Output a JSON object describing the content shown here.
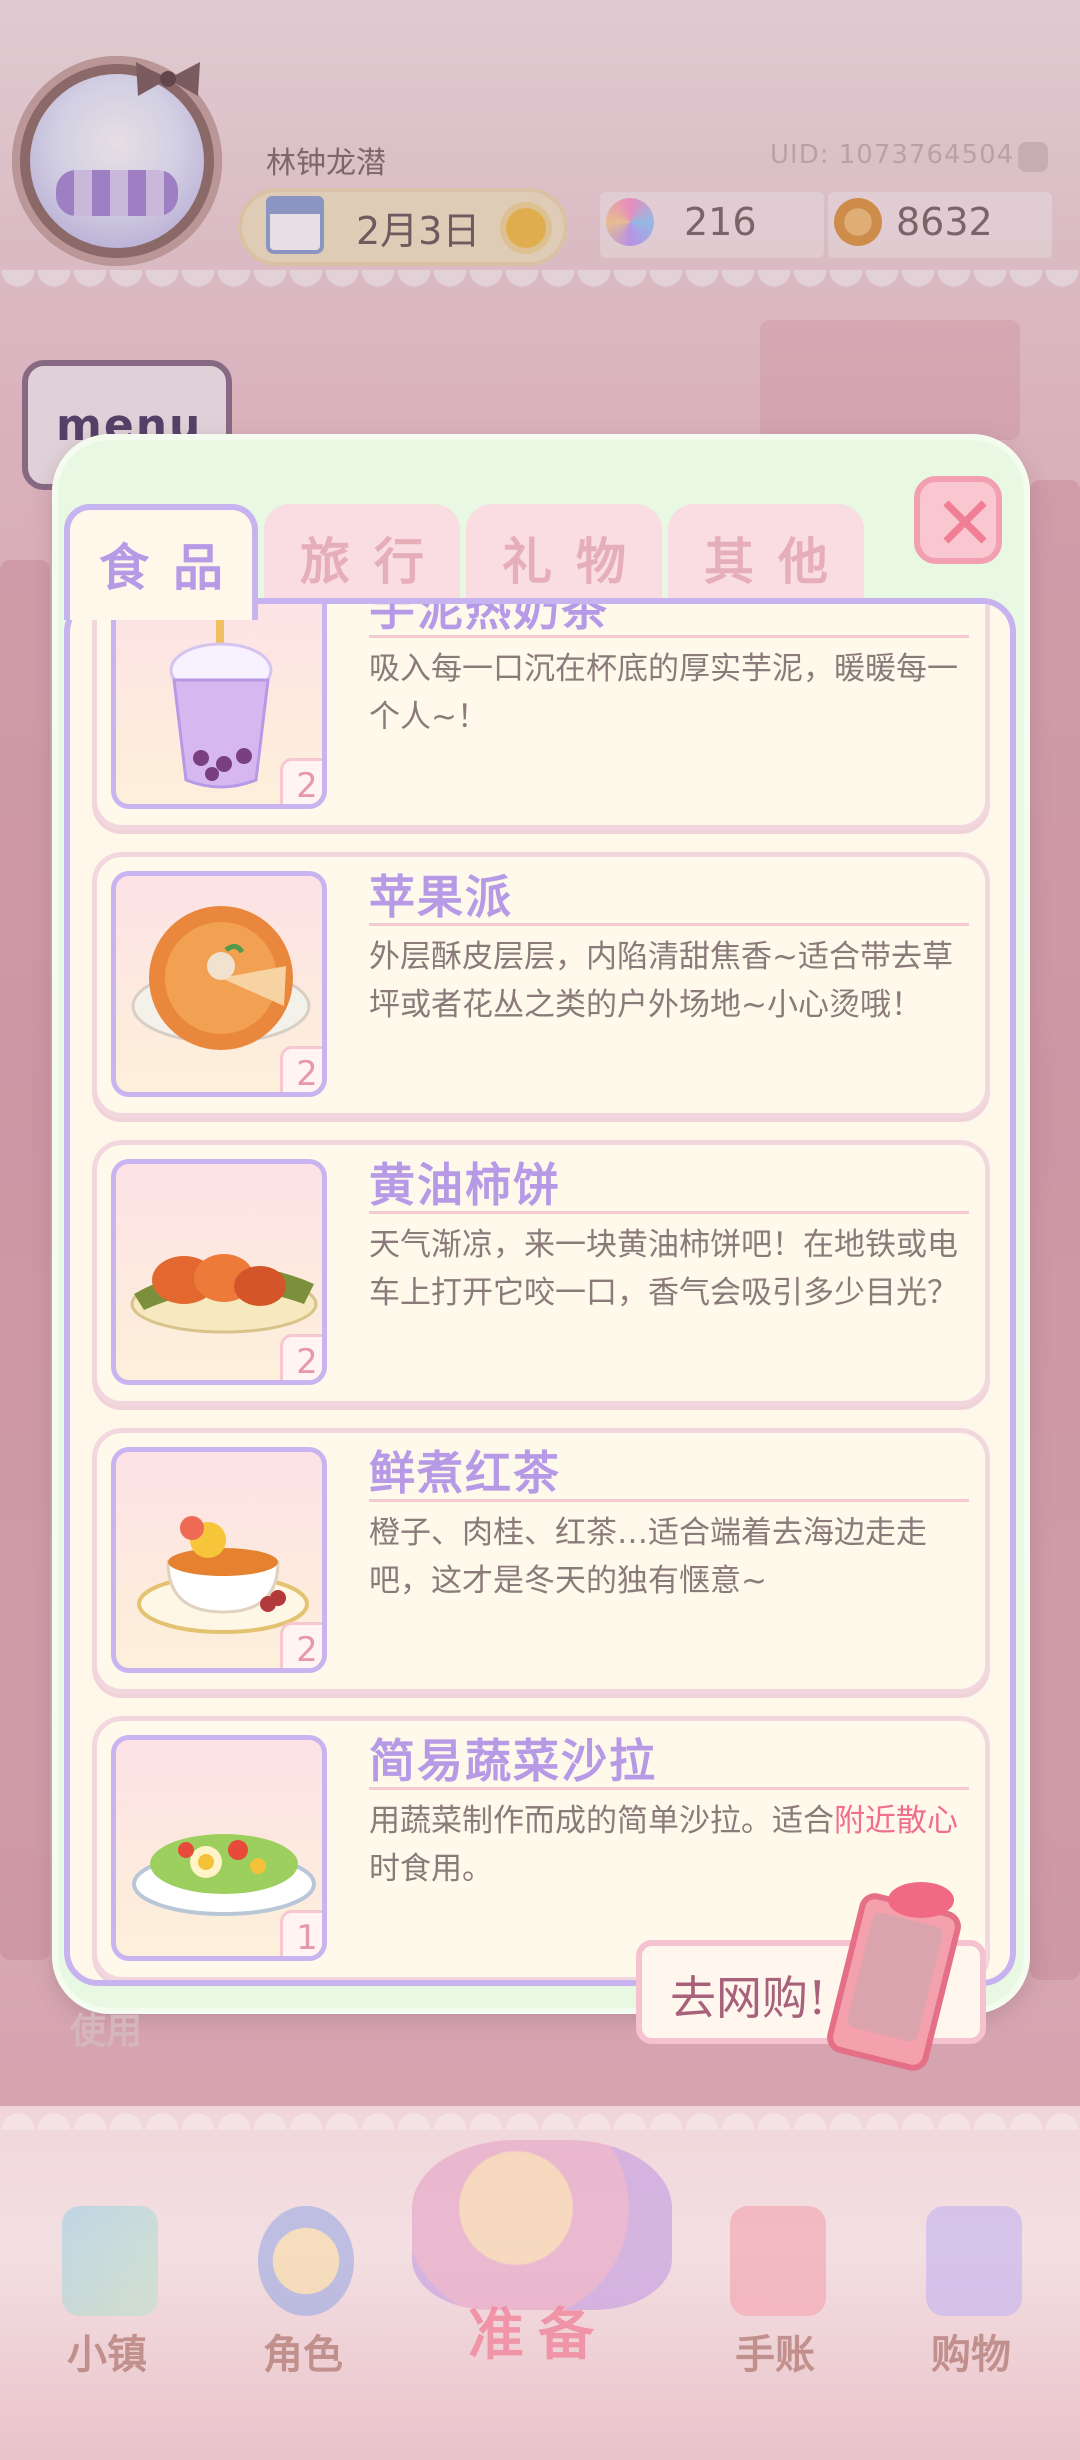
{
  "header": {
    "username": "林钟龙潜",
    "uid": "UID: 1073764504",
    "date": "2月3日",
    "gems": "216",
    "coins": "8632",
    "menu_label": "menu"
  },
  "tabs": [
    {
      "label": "食品",
      "active": true
    },
    {
      "label": "旅行",
      "active": false
    },
    {
      "label": "礼物",
      "active": false
    },
    {
      "label": "其他",
      "active": false
    }
  ],
  "items": [
    {
      "title": "芋泥热奶茶",
      "desc": "吸入每一口沉在杯底的厚实芋泥，暖暖每一个人~！",
      "qty": "2",
      "icon": "taro-milk-tea-icon"
    },
    {
      "title": "苹果派",
      "desc": "外层酥皮层层，内陷清甜焦香~适合带去草坪或者花丛之类的户外场地~小心烫哦！",
      "qty": "2",
      "icon": "apple-pie-icon"
    },
    {
      "title": "黄油柿饼",
      "desc": "天气渐凉，来一块黄油柿饼吧！在地铁或电车上打开它咬一口，香气会吸引多少目光？",
      "qty": "2",
      "icon": "persimmon-cake-icon"
    },
    {
      "title": "鲜煮红茶",
      "desc": "橙子、肉桂、红茶…适合端着去海边走走吧，这才是冬天的独有惬意~",
      "qty": "2",
      "icon": "black-tea-icon"
    },
    {
      "title": "简易蔬菜沙拉",
      "desc_before": "用蔬菜制作而成的简单沙拉。适合",
      "desc_highlight": "附近散心",
      "desc_after": "时食用。",
      "qty": "1",
      "icon": "salad-icon"
    }
  ],
  "shop_button": "去网购!",
  "behind_label": "使用",
  "nav": {
    "town": "小镇",
    "character": "角色",
    "prepare": "准备",
    "notebook": "手账",
    "shopping": "购物"
  },
  "colors": {
    "accent_purple": "#b79ae6",
    "highlight_pink": "#ef6f8c",
    "panel_green": "#e8f8e2",
    "card_cream": "#fff9ec"
  }
}
